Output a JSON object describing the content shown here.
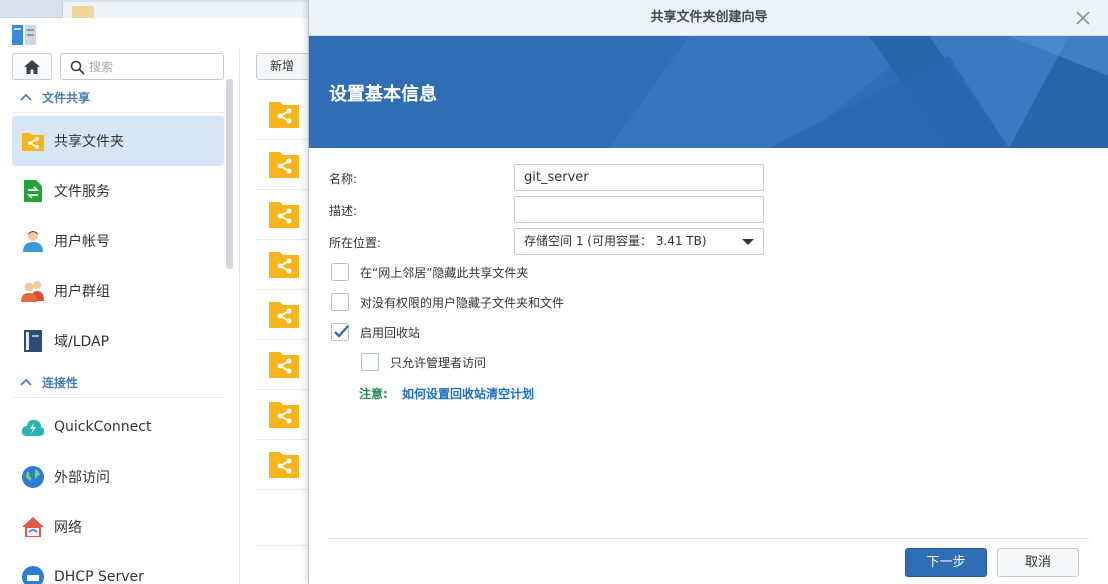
{
  "sidebar": {
    "search_placeholder": "搜索",
    "sections": {
      "file_sharing": "文件共享",
      "connectivity": "连接性"
    },
    "items": [
      {
        "label": "共享文件夹",
        "icon": "shared-folder-icon",
        "active": true
      },
      {
        "label": "文件服务",
        "icon": "file-services-icon"
      },
      {
        "label": "用户帐号",
        "icon": "user-icon"
      },
      {
        "label": "用户群组",
        "icon": "group-icon"
      },
      {
        "label": "域/LDAP",
        "icon": "domain-ldap-icon"
      },
      {
        "label": "QuickConnect",
        "icon": "quickconnect-icon"
      },
      {
        "label": "外部访问",
        "icon": "external-access-icon"
      },
      {
        "label": "网络",
        "icon": "network-icon"
      },
      {
        "label": "DHCP Server",
        "icon": "dhcp-server-icon"
      }
    ]
  },
  "toolbar": {
    "new_label": "新增"
  },
  "wizard": {
    "title": "共享文件夹创建向导",
    "heading": "设置基本信息",
    "fields": {
      "name_label": "名称:",
      "name_value": "git_server",
      "desc_label": "描述:",
      "desc_value": "",
      "location_label": "所在位置:",
      "location_value": "存储空间 1 (可用容量： 3.41 TB)"
    },
    "checkboxes": [
      {
        "label": "在“网上邻居”隐藏此共享文件夹",
        "checked": false
      },
      {
        "label": "对没有权限的用户隐藏子文件夹和文件",
        "checked": false
      },
      {
        "label": "启用回收站",
        "checked": true
      },
      {
        "label": "只允许管理者访问",
        "checked": false
      }
    ],
    "note_label": "注意:",
    "note_link": "如何设置回收站清空计划",
    "next_label": "下一步",
    "cancel_label": "取消"
  },
  "colors": {
    "accent": "#2f6db5",
    "section_text": "#4a7db5",
    "active_bg": "#d6e6f5",
    "folder": "#f6b51a",
    "note_green": "#2e8b57",
    "link": "#1b6fc2"
  }
}
